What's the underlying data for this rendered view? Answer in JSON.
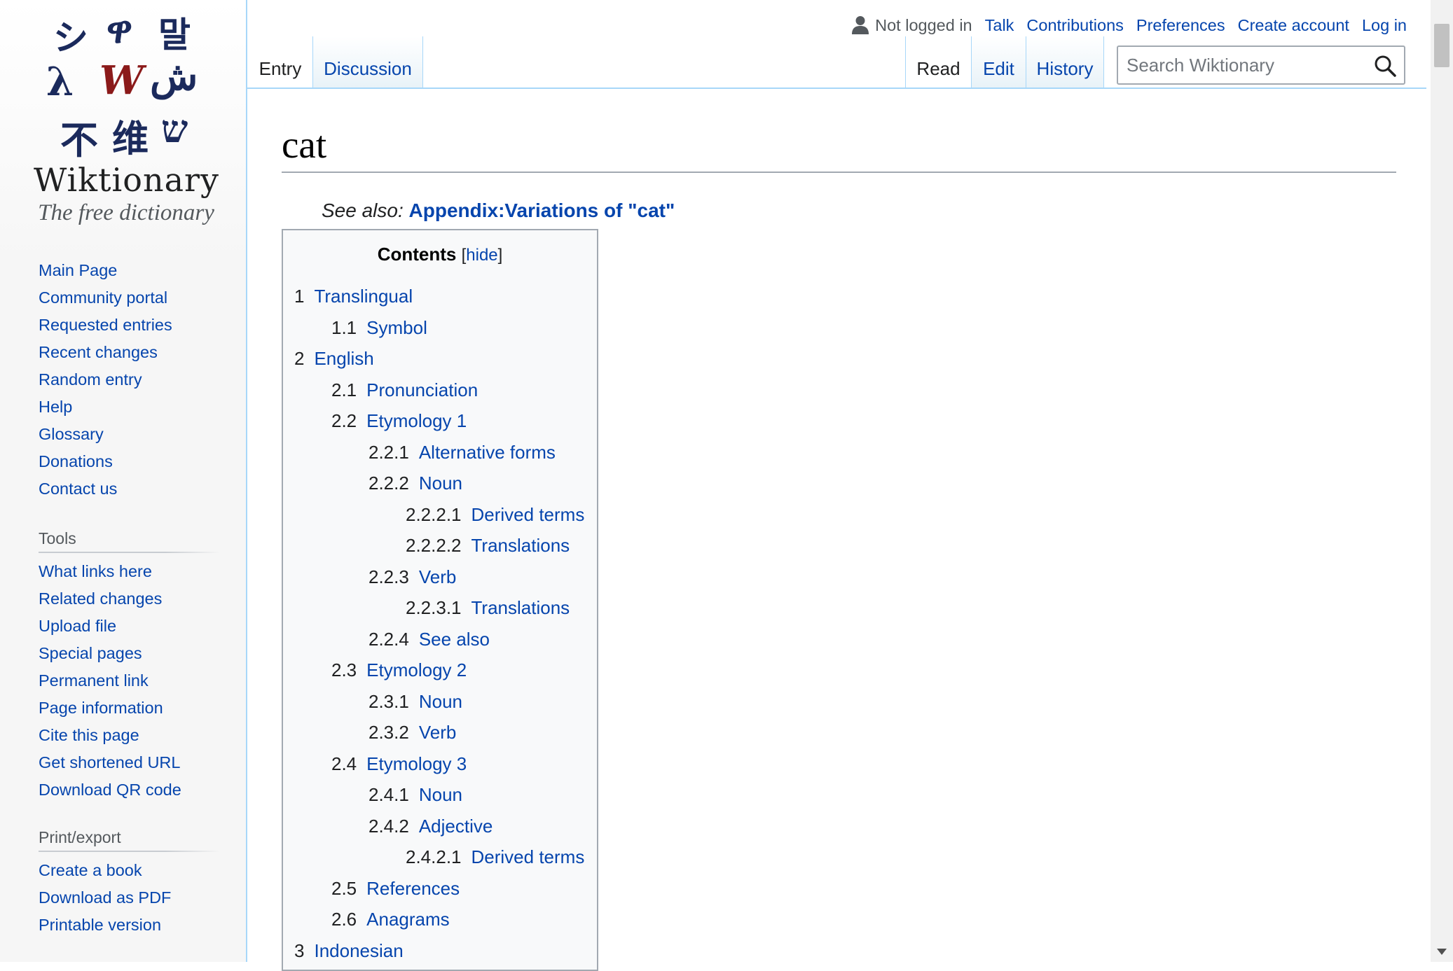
{
  "logo": {
    "glyphs": [
      "シ",
      "ዋ",
      "말",
      "λ",
      "W",
      "ش",
      "不",
      "维",
      "ש"
    ],
    "wordmark": "Wiktionary",
    "tagline": "The free dictionary"
  },
  "sidebar": {
    "navigation": [
      {
        "label": "Main Page"
      },
      {
        "label": "Community portal"
      },
      {
        "label": "Requested entries"
      },
      {
        "label": "Recent changes"
      },
      {
        "label": "Random entry"
      },
      {
        "label": "Help"
      },
      {
        "label": "Glossary"
      },
      {
        "label": "Donations"
      },
      {
        "label": "Contact us"
      }
    ],
    "tools": {
      "heading": "Tools",
      "items": [
        {
          "label": "What links here"
        },
        {
          "label": "Related changes"
        },
        {
          "label": "Upload file"
        },
        {
          "label": "Special pages"
        },
        {
          "label": "Permanent link"
        },
        {
          "label": "Page information"
        },
        {
          "label": "Cite this page"
        },
        {
          "label": "Get shortened URL"
        },
        {
          "label": "Download QR code"
        }
      ]
    },
    "print_export": {
      "heading": "Print/export",
      "items": [
        {
          "label": "Create a book"
        },
        {
          "label": "Download as PDF"
        },
        {
          "label": "Printable version"
        }
      ]
    }
  },
  "personal_tools": {
    "status": "Not logged in",
    "links": [
      "Talk",
      "Contributions",
      "Preferences",
      "Create account",
      "Log in"
    ]
  },
  "tabs": {
    "namespaces": [
      {
        "label": "Entry",
        "selected": true
      },
      {
        "label": "Discussion",
        "selected": false
      }
    ],
    "views": [
      {
        "label": "Read",
        "selected": true
      },
      {
        "label": "Edit",
        "selected": false
      },
      {
        "label": "History",
        "selected": false
      }
    ]
  },
  "search": {
    "placeholder": "Search Wiktionary",
    "value": ""
  },
  "page": {
    "title": "cat",
    "see_also_label": "See also:",
    "see_also_link": "Appendix:Variations of \"cat\""
  },
  "toc": {
    "title": "Contents",
    "toggle_open": "[",
    "toggle": "hide",
    "toggle_close": "]",
    "items": [
      {
        "num": "1",
        "label": "Translingual",
        "level": 1
      },
      {
        "num": "1.1",
        "label": "Symbol",
        "level": 2
      },
      {
        "num": "2",
        "label": "English",
        "level": 1
      },
      {
        "num": "2.1",
        "label": "Pronunciation",
        "level": 2
      },
      {
        "num": "2.2",
        "label": "Etymology 1",
        "level": 2
      },
      {
        "num": "2.2.1",
        "label": "Alternative forms",
        "level": 3
      },
      {
        "num": "2.2.2",
        "label": "Noun",
        "level": 3
      },
      {
        "num": "2.2.2.1",
        "label": "Derived terms",
        "level": 4
      },
      {
        "num": "2.2.2.2",
        "label": "Translations",
        "level": 4
      },
      {
        "num": "2.2.3",
        "label": "Verb",
        "level": 3
      },
      {
        "num": "2.2.3.1",
        "label": "Translations",
        "level": 4
      },
      {
        "num": "2.2.4",
        "label": "See also",
        "level": 3
      },
      {
        "num": "2.3",
        "label": "Etymology 2",
        "level": 2
      },
      {
        "num": "2.3.1",
        "label": "Noun",
        "level": 3
      },
      {
        "num": "2.3.2",
        "label": "Verb",
        "level": 3
      },
      {
        "num": "2.4",
        "label": "Etymology 3",
        "level": 2
      },
      {
        "num": "2.4.1",
        "label": "Noun",
        "level": 3
      },
      {
        "num": "2.4.2",
        "label": "Adjective",
        "level": 3
      },
      {
        "num": "2.4.2.1",
        "label": "Derived terms",
        "level": 4
      },
      {
        "num": "2.5",
        "label": "References",
        "level": 2
      },
      {
        "num": "2.6",
        "label": "Anagrams",
        "level": 2
      },
      {
        "num": "3",
        "label": "Indonesian",
        "level": 1
      }
    ]
  },
  "colors": {
    "link": "#0645ad",
    "text": "#202122",
    "border": "#a7d7f9",
    "toc_background": "#f8f9fa",
    "logo_glyph": "#1b2a5c",
    "logo_w": "#8b1a1a"
  },
  "icons": [
    "user-icon",
    "search-icon"
  ]
}
